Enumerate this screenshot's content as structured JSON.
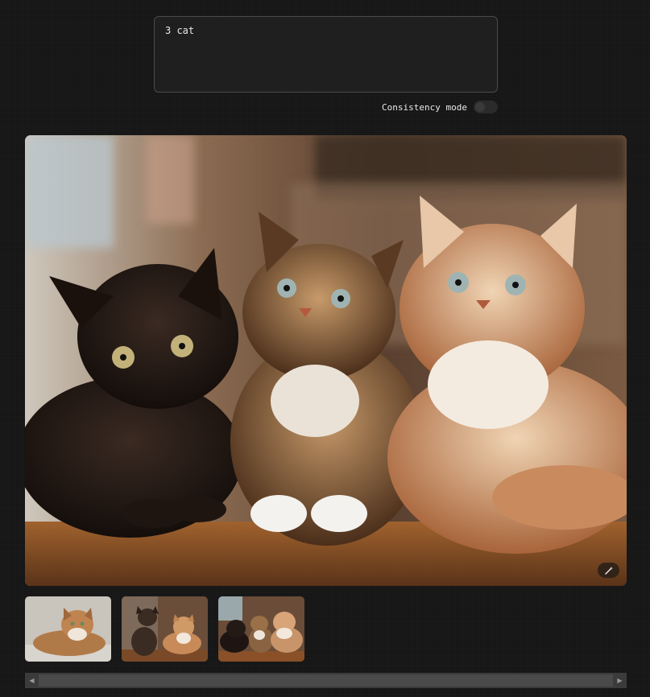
{
  "prompt": {
    "value": "3 cat"
  },
  "consistency": {
    "label": "Consistency mode",
    "enabled": false
  },
  "main_image": {
    "alt": "three cats lying on a wooden floor",
    "action_icon": "magic-wand-icon"
  },
  "thumbnails": [
    {
      "alt": "single orange tabby cat lying down"
    },
    {
      "alt": "two cats sitting"
    },
    {
      "alt": "three cats lying on a wooden floor"
    }
  ],
  "scrollbar": {
    "left_arrow": "◀",
    "right_arrow": "▶"
  },
  "colors": {
    "background": "#151515",
    "panel": "#1f1f1f",
    "border": "#4a4a4a"
  }
}
